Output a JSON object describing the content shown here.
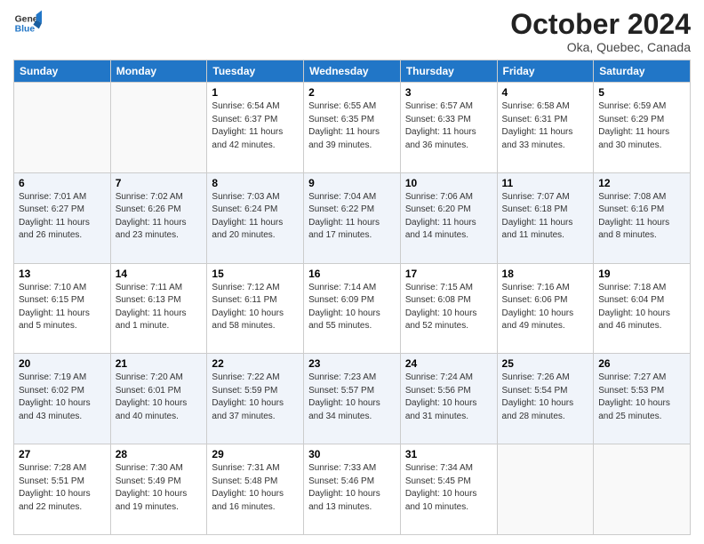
{
  "header": {
    "logo_line1": "General",
    "logo_line2": "Blue",
    "month": "October 2024",
    "location": "Oka, Quebec, Canada"
  },
  "weekdays": [
    "Sunday",
    "Monday",
    "Tuesday",
    "Wednesday",
    "Thursday",
    "Friday",
    "Saturday"
  ],
  "weeks": [
    [
      {
        "day": "",
        "sunrise": "",
        "sunset": "",
        "daylight": ""
      },
      {
        "day": "",
        "sunrise": "",
        "sunset": "",
        "daylight": ""
      },
      {
        "day": "1",
        "sunrise": "Sunrise: 6:54 AM",
        "sunset": "Sunset: 6:37 PM",
        "daylight": "Daylight: 11 hours and 42 minutes."
      },
      {
        "day": "2",
        "sunrise": "Sunrise: 6:55 AM",
        "sunset": "Sunset: 6:35 PM",
        "daylight": "Daylight: 11 hours and 39 minutes."
      },
      {
        "day": "3",
        "sunrise": "Sunrise: 6:57 AM",
        "sunset": "Sunset: 6:33 PM",
        "daylight": "Daylight: 11 hours and 36 minutes."
      },
      {
        "day": "4",
        "sunrise": "Sunrise: 6:58 AM",
        "sunset": "Sunset: 6:31 PM",
        "daylight": "Daylight: 11 hours and 33 minutes."
      },
      {
        "day": "5",
        "sunrise": "Sunrise: 6:59 AM",
        "sunset": "Sunset: 6:29 PM",
        "daylight": "Daylight: 11 hours and 30 minutes."
      }
    ],
    [
      {
        "day": "6",
        "sunrise": "Sunrise: 7:01 AM",
        "sunset": "Sunset: 6:27 PM",
        "daylight": "Daylight: 11 hours and 26 minutes."
      },
      {
        "day": "7",
        "sunrise": "Sunrise: 7:02 AM",
        "sunset": "Sunset: 6:26 PM",
        "daylight": "Daylight: 11 hours and 23 minutes."
      },
      {
        "day": "8",
        "sunrise": "Sunrise: 7:03 AM",
        "sunset": "Sunset: 6:24 PM",
        "daylight": "Daylight: 11 hours and 20 minutes."
      },
      {
        "day": "9",
        "sunrise": "Sunrise: 7:04 AM",
        "sunset": "Sunset: 6:22 PM",
        "daylight": "Daylight: 11 hours and 17 minutes."
      },
      {
        "day": "10",
        "sunrise": "Sunrise: 7:06 AM",
        "sunset": "Sunset: 6:20 PM",
        "daylight": "Daylight: 11 hours and 14 minutes."
      },
      {
        "day": "11",
        "sunrise": "Sunrise: 7:07 AM",
        "sunset": "Sunset: 6:18 PM",
        "daylight": "Daylight: 11 hours and 11 minutes."
      },
      {
        "day": "12",
        "sunrise": "Sunrise: 7:08 AM",
        "sunset": "Sunset: 6:16 PM",
        "daylight": "Daylight: 11 hours and 8 minutes."
      }
    ],
    [
      {
        "day": "13",
        "sunrise": "Sunrise: 7:10 AM",
        "sunset": "Sunset: 6:15 PM",
        "daylight": "Daylight: 11 hours and 5 minutes."
      },
      {
        "day": "14",
        "sunrise": "Sunrise: 7:11 AM",
        "sunset": "Sunset: 6:13 PM",
        "daylight": "Daylight: 11 hours and 1 minute."
      },
      {
        "day": "15",
        "sunrise": "Sunrise: 7:12 AM",
        "sunset": "Sunset: 6:11 PM",
        "daylight": "Daylight: 10 hours and 58 minutes."
      },
      {
        "day": "16",
        "sunrise": "Sunrise: 7:14 AM",
        "sunset": "Sunset: 6:09 PM",
        "daylight": "Daylight: 10 hours and 55 minutes."
      },
      {
        "day": "17",
        "sunrise": "Sunrise: 7:15 AM",
        "sunset": "Sunset: 6:08 PM",
        "daylight": "Daylight: 10 hours and 52 minutes."
      },
      {
        "day": "18",
        "sunrise": "Sunrise: 7:16 AM",
        "sunset": "Sunset: 6:06 PM",
        "daylight": "Daylight: 10 hours and 49 minutes."
      },
      {
        "day": "19",
        "sunrise": "Sunrise: 7:18 AM",
        "sunset": "Sunset: 6:04 PM",
        "daylight": "Daylight: 10 hours and 46 minutes."
      }
    ],
    [
      {
        "day": "20",
        "sunrise": "Sunrise: 7:19 AM",
        "sunset": "Sunset: 6:02 PM",
        "daylight": "Daylight: 10 hours and 43 minutes."
      },
      {
        "day": "21",
        "sunrise": "Sunrise: 7:20 AM",
        "sunset": "Sunset: 6:01 PM",
        "daylight": "Daylight: 10 hours and 40 minutes."
      },
      {
        "day": "22",
        "sunrise": "Sunrise: 7:22 AM",
        "sunset": "Sunset: 5:59 PM",
        "daylight": "Daylight: 10 hours and 37 minutes."
      },
      {
        "day": "23",
        "sunrise": "Sunrise: 7:23 AM",
        "sunset": "Sunset: 5:57 PM",
        "daylight": "Daylight: 10 hours and 34 minutes."
      },
      {
        "day": "24",
        "sunrise": "Sunrise: 7:24 AM",
        "sunset": "Sunset: 5:56 PM",
        "daylight": "Daylight: 10 hours and 31 minutes."
      },
      {
        "day": "25",
        "sunrise": "Sunrise: 7:26 AM",
        "sunset": "Sunset: 5:54 PM",
        "daylight": "Daylight: 10 hours and 28 minutes."
      },
      {
        "day": "26",
        "sunrise": "Sunrise: 7:27 AM",
        "sunset": "Sunset: 5:53 PM",
        "daylight": "Daylight: 10 hours and 25 minutes."
      }
    ],
    [
      {
        "day": "27",
        "sunrise": "Sunrise: 7:28 AM",
        "sunset": "Sunset: 5:51 PM",
        "daylight": "Daylight: 10 hours and 22 minutes."
      },
      {
        "day": "28",
        "sunrise": "Sunrise: 7:30 AM",
        "sunset": "Sunset: 5:49 PM",
        "daylight": "Daylight: 10 hours and 19 minutes."
      },
      {
        "day": "29",
        "sunrise": "Sunrise: 7:31 AM",
        "sunset": "Sunset: 5:48 PM",
        "daylight": "Daylight: 10 hours and 16 minutes."
      },
      {
        "day": "30",
        "sunrise": "Sunrise: 7:33 AM",
        "sunset": "Sunset: 5:46 PM",
        "daylight": "Daylight: 10 hours and 13 minutes."
      },
      {
        "day": "31",
        "sunrise": "Sunrise: 7:34 AM",
        "sunset": "Sunset: 5:45 PM",
        "daylight": "Daylight: 10 hours and 10 minutes."
      },
      {
        "day": "",
        "sunrise": "",
        "sunset": "",
        "daylight": ""
      },
      {
        "day": "",
        "sunrise": "",
        "sunset": "",
        "daylight": ""
      }
    ]
  ]
}
